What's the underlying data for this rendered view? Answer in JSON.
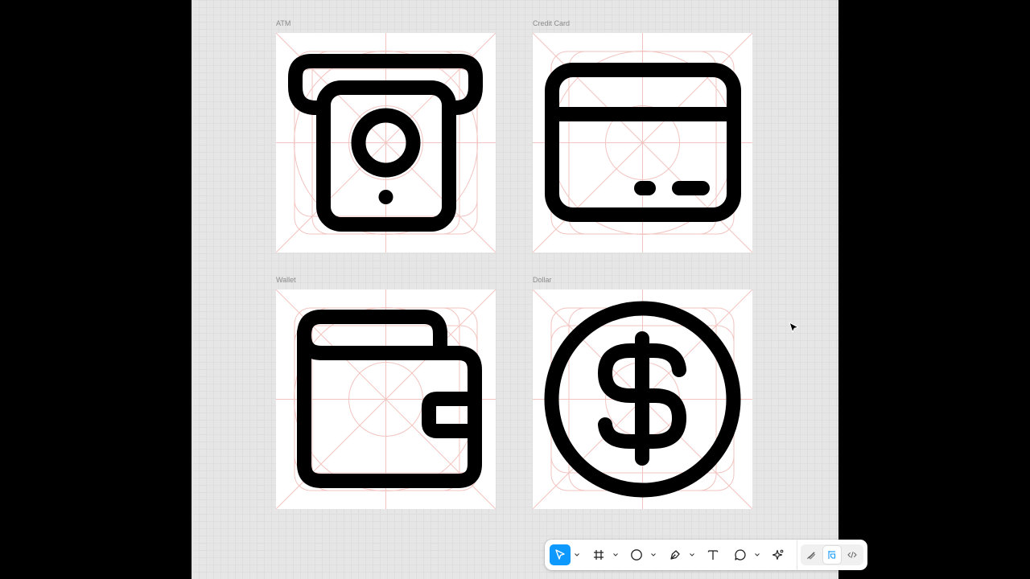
{
  "canvas": {
    "frames": [
      {
        "label": "ATM",
        "icon": "atm-icon"
      },
      {
        "label": "Credit Card",
        "icon": "credit-card-icon"
      },
      {
        "label": "Wallet",
        "icon": "wallet-icon"
      },
      {
        "label": "Dollar",
        "icon": "dollar-coin-icon"
      }
    ]
  },
  "toolbar": {
    "tools": [
      {
        "name": "move",
        "icon": "cursor-arrow-icon",
        "active": true
      },
      {
        "name": "frame",
        "icon": "frame-hash-icon"
      },
      {
        "name": "shape",
        "icon": "ellipse-icon"
      },
      {
        "name": "pen",
        "icon": "pen-icon"
      },
      {
        "name": "text",
        "icon": "text-icon"
      },
      {
        "name": "comment",
        "icon": "comment-icon"
      },
      {
        "name": "actions",
        "icon": "sparkle-actions-icon"
      }
    ],
    "modes": [
      {
        "name": "draw",
        "icon": "draw-mode-icon"
      },
      {
        "name": "design",
        "icon": "design-mode-icon",
        "active": true
      },
      {
        "name": "dev",
        "icon": "dev-mode-icon"
      }
    ]
  },
  "colors": {
    "canvas_bg": "#e6e6e6",
    "grid_line": "#dedede",
    "keyline": "#f2c4c0",
    "icon_stroke": "#000000",
    "accent": "#0d99ff"
  }
}
